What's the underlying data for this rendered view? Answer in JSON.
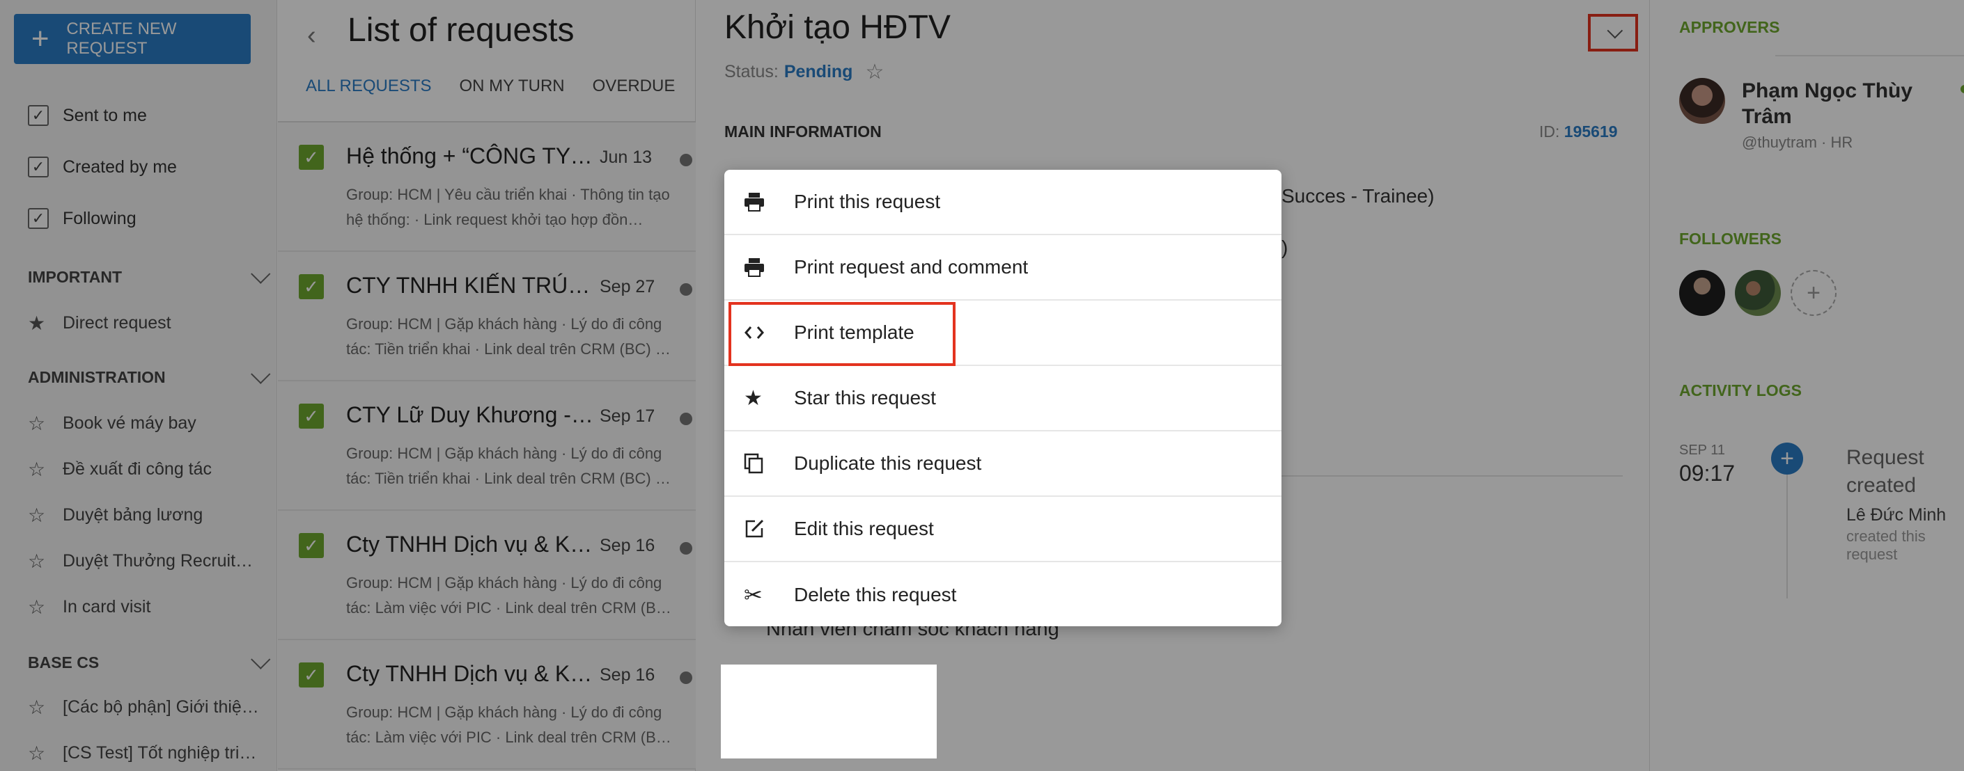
{
  "sidebar": {
    "create_label": "CREATE NEW REQUEST",
    "filters": [
      {
        "label": "Sent to me"
      },
      {
        "label": "Created by me"
      },
      {
        "label": "Following"
      }
    ],
    "sections": [
      {
        "title": "IMPORTANT",
        "items": [
          "Direct request"
        ]
      },
      {
        "title": "ADMINISTRATION",
        "items": [
          "Book vé máy bay",
          "Đề xuất đi công tác",
          "Duyệt bảng lương",
          "Duyệt Thưởng Recruit…",
          "In card visit"
        ]
      },
      {
        "title": "BASE CS",
        "items": [
          "[Các bộ phận] Giới thiệ…",
          "[CS Test] Tốt nghiệp tri…"
        ]
      }
    ]
  },
  "list": {
    "title": "List of requests",
    "tabs": [
      "ALL REQUESTS",
      "ON MY TURN",
      "OVERDUE"
    ],
    "items": [
      {
        "title": "Hệ thống + “CÔNG TY C…",
        "date": "Jun 13",
        "desc": "Group: HCM | Yêu cầu triển khai · Thông tin tạo hệ thống: · Link request khởi tạo hợp đồn…"
      },
      {
        "title": "CTY TNHH KIẾN TRÚC…",
        "date": "Sep 27",
        "desc": "Group: HCM | Gặp khách hàng · Lý do đi công tác: Tiền triển khai · Link deal trên CRM (BC) …"
      },
      {
        "title": "CTY Lữ Duy Khương -…",
        "date": "Sep 17",
        "desc": "Group: HCM | Gặp khách hàng · Lý do đi công tác: Tiền triển khai · Link deal trên CRM (BC) …"
      },
      {
        "title": "Cty TNHH Dịch vụ & Kỹ…",
        "date": "Sep 16",
        "desc": "Group: HCM | Gặp khách hàng · Lý do đi công tác: Làm việc với PIC · Link deal trên CRM (B…"
      },
      {
        "title": "Cty TNHH Dịch vụ & Kỹ…",
        "date": "Sep 16",
        "desc": "Group: HCM | Gặp khách hàng · Lý do đi công tác: Làm việc với PIC · Link deal trên CRM (B…"
      }
    ]
  },
  "detail": {
    "title": "Khởi tạo HĐTV",
    "status_label": "Status:",
    "status_value": "Pending",
    "section_title": "MAIN INFORMATION",
    "id_label": "ID:",
    "id_value": "195619",
    "bg_text_1": "Succes - Trainee)",
    "bg_text_2": ")",
    "bg_text_3": "Nhân viên chăm sóc khách hàng"
  },
  "menu": {
    "items": [
      {
        "label": "Print this request",
        "icon": "printer-icon"
      },
      {
        "label": "Print request and comment",
        "icon": "printer-icon"
      },
      {
        "label": "Print template",
        "icon": "code-icon"
      },
      {
        "label": "Star this request",
        "icon": "star-icon"
      },
      {
        "label": "Duplicate this request",
        "icon": "duplicate-icon"
      },
      {
        "label": "Edit this request",
        "icon": "edit-icon"
      },
      {
        "label": "Delete this request",
        "icon": "scissors-icon"
      }
    ]
  },
  "right": {
    "approvers_title": "APPROVERS",
    "approver_name": "Phạm Ngọc Thùy Trâm",
    "approver_handle": "@thuytram",
    "approver_dept": " · HR",
    "followers_title": "FOLLOWERS",
    "activity_title": "ACTIVITY LOGS",
    "log_date": "SEP 11",
    "log_time": "09:17",
    "log_title": "Request created",
    "log_user": "Lê Đức Minh",
    "log_desc": "created this request"
  },
  "colors": {
    "accent": "#2b7cc5",
    "success": "#6fa82f",
    "highlight": "#e3331f"
  }
}
